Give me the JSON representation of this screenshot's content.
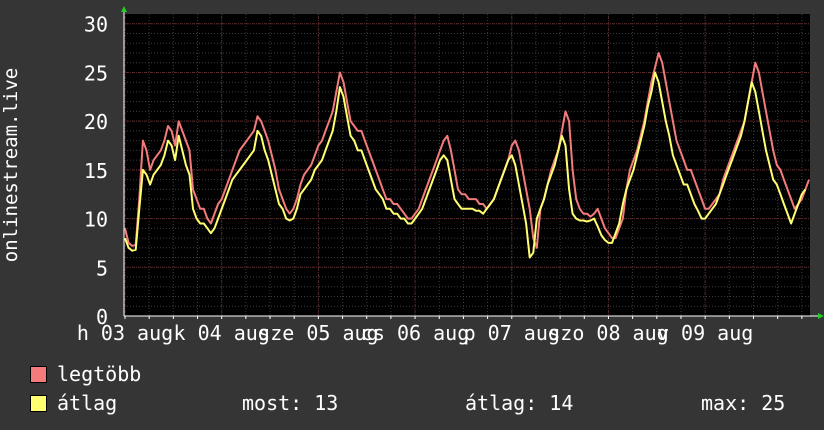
{
  "chart_data": {
    "type": "line",
    "ylabel": "onlinestream.live",
    "ylim": [
      0,
      31
    ],
    "yticks": [
      0,
      5,
      10,
      15,
      20,
      25,
      30
    ],
    "xtick_labels": [
      "h 03 aug",
      "k 04 aug",
      "sze 05 aug",
      "cs 06 aug",
      "p 07 aug",
      "szo 08 aug",
      "v 09 aug"
    ],
    "grid": true,
    "colors": {
      "background": "#353535",
      "plot": "#000000",
      "grid": "#5a2a2a",
      "max": "#f47b7b",
      "avg": "#ffff70"
    },
    "series": [
      {
        "name": "legtöbb",
        "values": [
          9,
          7.5,
          7.2,
          7.3,
          12,
          18,
          17,
          15,
          16,
          16.5,
          17,
          18,
          19.5,
          19,
          17.5,
          20,
          19,
          18,
          17,
          13,
          12,
          11,
          11,
          10,
          9.5,
          10.5,
          11.5,
          12,
          13,
          14,
          15,
          16,
          17,
          17.5,
          18,
          18.5,
          19,
          20.5,
          20,
          19,
          18,
          16.5,
          15,
          13,
          12,
          11,
          10.5,
          11,
          12,
          13.5,
          14.5,
          15,
          15.5,
          16.5,
          17.5,
          18,
          19,
          20,
          21,
          23,
          25,
          24,
          22,
          20,
          19.5,
          19,
          19,
          18,
          17,
          16,
          15,
          14,
          13,
          12,
          12,
          11.5,
          11.5,
          11,
          10.5,
          10,
          10,
          10.5,
          11,
          12,
          13,
          14,
          15,
          16,
          17,
          18,
          18.5,
          17,
          15,
          13,
          12.5,
          12.5,
          12,
          12,
          12,
          11.5,
          11.5,
          11,
          11.5,
          12,
          13,
          14,
          15,
          16,
          17.5,
          18,
          17,
          15,
          13,
          11,
          8,
          7,
          11,
          12,
          13.5,
          15,
          16,
          17,
          19,
          21,
          20,
          15,
          12,
          11,
          10.5,
          10.5,
          10.2,
          10.5,
          11,
          10,
          9,
          8.5,
          8,
          8,
          9,
          10,
          13,
          15,
          16,
          17,
          18.5,
          20,
          22,
          24,
          25.5,
          27,
          26,
          24,
          22,
          20,
          18,
          17,
          16,
          15,
          15,
          14,
          13,
          12,
          11,
          11,
          11.5,
          12,
          12.5,
          14,
          15,
          16,
          17,
          18,
          19,
          20,
          22,
          24,
          26,
          25,
          23,
          21,
          19,
          17,
          15.5,
          15,
          14,
          13,
          12,
          11,
          11.5,
          12,
          13,
          14
        ],
        "points_per_day": 27
      },
      {
        "name": "átlag",
        "values": [
          8,
          7,
          6.7,
          6.8,
          11,
          15,
          14.5,
          13.5,
          14.5,
          15,
          15.5,
          16.5,
          18,
          17.5,
          16,
          18.5,
          17,
          15.5,
          14.5,
          11,
          10,
          9.5,
          9.5,
          9,
          8.5,
          9,
          10,
          11,
          12,
          13,
          14,
          14.5,
          15,
          15.5,
          16,
          16.5,
          17,
          19,
          18.5,
          17,
          16,
          14.5,
          13,
          11.5,
          11,
          10,
          9.8,
          10,
          11,
          12.5,
          13,
          13.5,
          14,
          15,
          15.5,
          16,
          17,
          18,
          19,
          21,
          23.5,
          22.5,
          20.5,
          18.5,
          18,
          17,
          17,
          16,
          15,
          14,
          13,
          12.5,
          12,
          11,
          11,
          10.5,
          10.5,
          10,
          10,
          9.5,
          9.5,
          10,
          10.5,
          11,
          12,
          13,
          14,
          15,
          16,
          16.5,
          16,
          14,
          12,
          11.5,
          11,
          11,
          11,
          11,
          10.8,
          10.8,
          10.5,
          11,
          11.5,
          12,
          13,
          14,
          15,
          16,
          16.5,
          15.5,
          13.5,
          11.5,
          9.5,
          6,
          6.5,
          10,
          11,
          12,
          13.5,
          14.5,
          15.5,
          17,
          18.5,
          17.5,
          13,
          10.5,
          10,
          9.8,
          9.8,
          9.7,
          9.8,
          10,
          9.2,
          8.3,
          7.8,
          7.5,
          7.5,
          8.5,
          9.5,
          11.5,
          13,
          14,
          15,
          16.5,
          18,
          19.5,
          21.5,
          23,
          25,
          24,
          22,
          20,
          18.5,
          16.5,
          15.5,
          14.5,
          13.5,
          13.5,
          12.5,
          11.5,
          10.8,
          10,
          10,
          10.5,
          11,
          11.5,
          12.5,
          13.5,
          14.5,
          15.5,
          16.5,
          17.5,
          18.5,
          20,
          22,
          24,
          23,
          21,
          19,
          17,
          15.5,
          14,
          13.5,
          12.5,
          11.5,
          10.5,
          9.5,
          10.5,
          11.5,
          12.5,
          13
        ]
      }
    ],
    "stats": {
      "most_label": "most:",
      "most": "13",
      "avg_label": "átlag:",
      "avg": "14",
      "max_label": "max:",
      "max": "25"
    }
  },
  "legend": {
    "max_label": "legtöbb",
    "avg_label": "átlag"
  }
}
